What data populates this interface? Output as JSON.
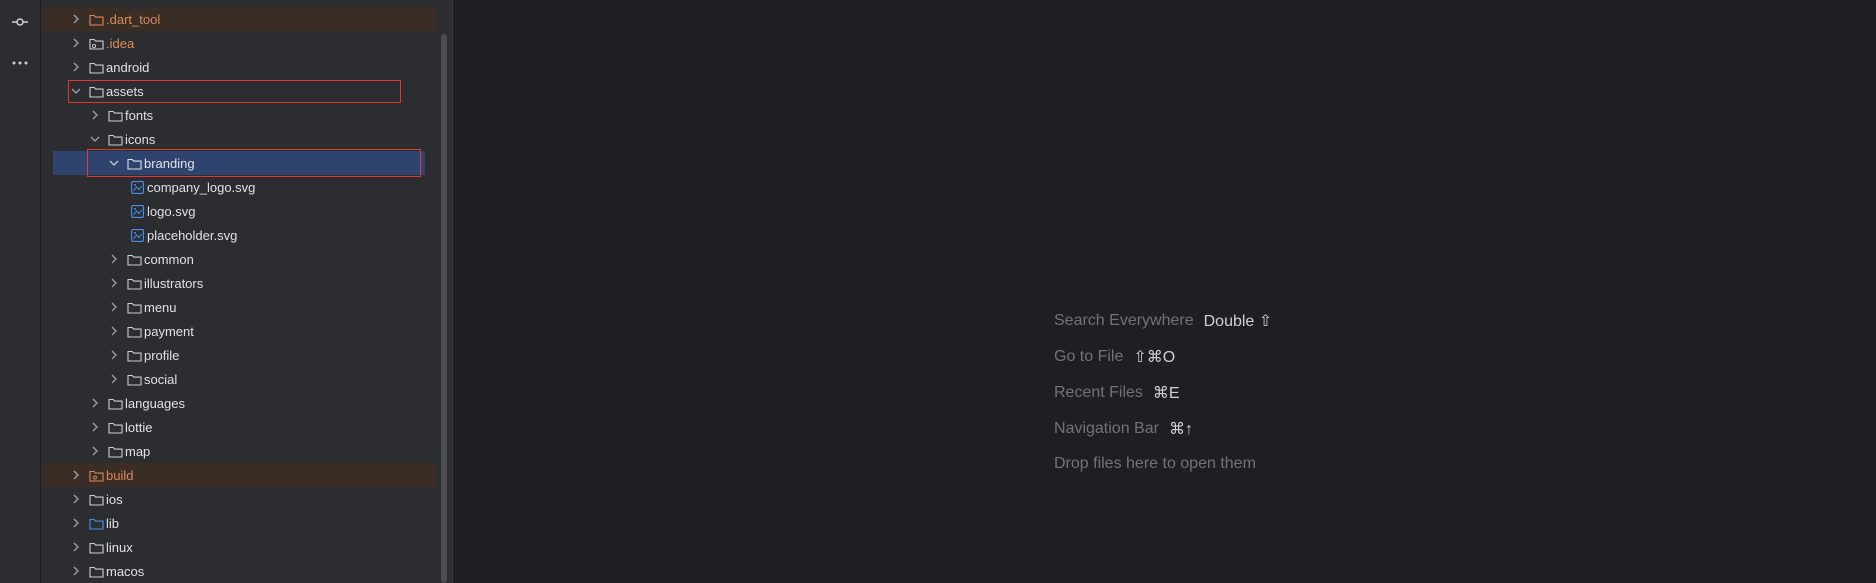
{
  "tool_rail": {
    "items": [
      {
        "name": "commit-icon"
      },
      {
        "name": "more-icon"
      }
    ]
  },
  "project_tree": {
    "items": [
      {
        "label": ".dart_tool",
        "kind": "folder-excluded",
        "expanded": false
      },
      {
        "label": ".idea",
        "kind": "folder-config",
        "expanded": false
      },
      {
        "label": "android",
        "kind": "folder",
        "expanded": false
      },
      {
        "label": "assets",
        "kind": "folder",
        "expanded": true
      },
      {
        "label": "fonts",
        "kind": "folder",
        "expanded": false
      },
      {
        "label": "icons",
        "kind": "folder",
        "expanded": true
      },
      {
        "label": "branding",
        "kind": "folder",
        "expanded": true,
        "selected": true
      },
      {
        "label": "company_logo.svg",
        "kind": "svg-file"
      },
      {
        "label": "logo.svg",
        "kind": "svg-file"
      },
      {
        "label": "placeholder.svg",
        "kind": "svg-file"
      },
      {
        "label": "common",
        "kind": "folder",
        "expanded": false
      },
      {
        "label": "illustrators",
        "kind": "folder",
        "expanded": false
      },
      {
        "label": "menu",
        "kind": "folder",
        "expanded": false
      },
      {
        "label": "payment",
        "kind": "folder",
        "expanded": false
      },
      {
        "label": "profile",
        "kind": "folder",
        "expanded": false
      },
      {
        "label": "social",
        "kind": "folder",
        "expanded": false
      },
      {
        "label": "languages",
        "kind": "folder",
        "expanded": false
      },
      {
        "label": "lottie",
        "kind": "folder",
        "expanded": false
      },
      {
        "label": "map",
        "kind": "folder",
        "expanded": false
      },
      {
        "label": "build",
        "kind": "folder-excluded",
        "expanded": false
      },
      {
        "label": "ios",
        "kind": "folder",
        "expanded": false
      },
      {
        "label": "lib",
        "kind": "folder-source",
        "expanded": false
      },
      {
        "label": "linux",
        "kind": "folder",
        "expanded": false
      },
      {
        "label": "macos",
        "kind": "folder",
        "expanded": false
      }
    ]
  },
  "editor_empty_state": {
    "search_everywhere": {
      "label": "Search Everywhere",
      "shortcut": "Double ⇧"
    },
    "go_to_file": {
      "label": "Go to File",
      "shortcut": "⇧⌘O"
    },
    "recent_files": {
      "label": "Recent Files",
      "shortcut": "⌘E"
    },
    "navigation_bar": {
      "label": "Navigation Bar",
      "shortcut": "⌘↑"
    },
    "drop_files": {
      "label": "Drop files here to open them"
    }
  },
  "colors": {
    "background": "#1e1f22",
    "panel": "#2b2d30",
    "selection": "#2e436e",
    "excluded_text": "#d9895a",
    "svg_icon": "#4a8ff0",
    "annotation_outline": "#e0392b"
  }
}
